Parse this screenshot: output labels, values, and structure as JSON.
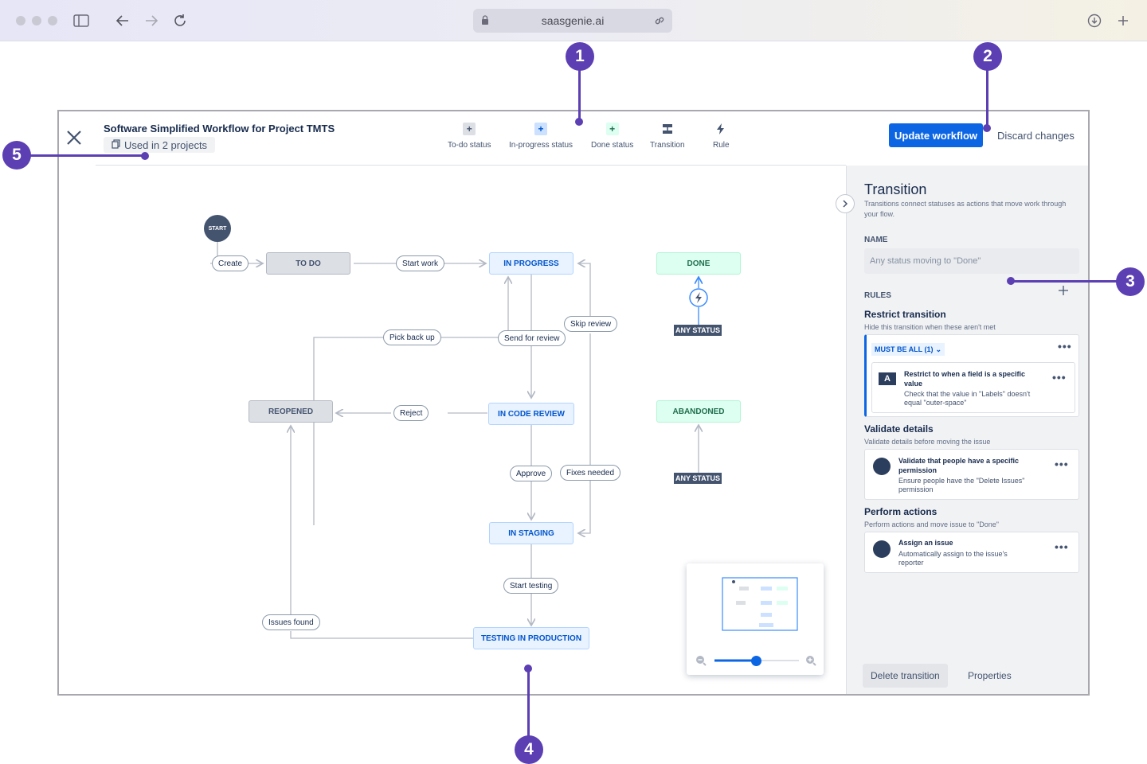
{
  "browser": {
    "url": "saasgenie.ai"
  },
  "markers": [
    "1",
    "2",
    "3",
    "4",
    "5"
  ],
  "header": {
    "workflow_title": "Software Simplified Workflow for Project TMTS",
    "used_badge": "Used in 2 projects",
    "update_button": "Update workflow",
    "discard_button": "Discard changes"
  },
  "toolbar": {
    "todo": "To-do status",
    "inprogress": "In-progress status",
    "done": "Done status",
    "transition": "Transition",
    "rule": "Rule"
  },
  "diagram": {
    "start": "START",
    "statuses": {
      "todo": "TO DO",
      "in_progress": "IN PROGRESS",
      "done": "DONE",
      "reopened": "REOPENED",
      "in_code_review": "IN CODE REVIEW",
      "abandoned": "ABANDONED",
      "in_staging": "IN STAGING",
      "testing_in_production": "TESTING IN PRODUCTION"
    },
    "transitions": {
      "create": "Create",
      "start_work": "Start work",
      "skip_review": "Skip review",
      "pick_back_up": "Pick back up",
      "send_for_review": "Send for review",
      "reject": "Reject",
      "approve": "Approve",
      "fixes_needed": "Fixes needed",
      "start_testing": "Start testing",
      "issues_found": "Issues found"
    },
    "any_status": "ANY STATUS"
  },
  "panel": {
    "title": "Transition",
    "description": "Transitions connect statuses as actions that move work through your flow.",
    "name_label": "NAME",
    "name_placeholder": "Any status moving to \"Done\"",
    "rules_label": "RULES",
    "restrict": {
      "title": "Restrict transition",
      "desc": "Hide this transition when these aren't met",
      "must_be_all": "MUST BE ALL (1)",
      "rule_title": "Restrict to when a field is a specific value",
      "rule_desc": "Check that the value in \"Labels\" doesn't equal \"outer-space\""
    },
    "validate": {
      "title": "Validate details",
      "desc": "Validate details before moving the issue",
      "rule_title": "Validate that people have a specific permission",
      "rule_desc": "Ensure people have the \"Delete Issues\" permission"
    },
    "perform": {
      "title": "Perform actions",
      "desc": "Perform actions and move issue to \"Done\"",
      "rule_title": "Assign an issue",
      "rule_desc": "Automatically assign to the issue's reporter"
    },
    "delete_button": "Delete transition",
    "properties_button": "Properties"
  },
  "colors": {
    "marker": "#5b3fb3",
    "primary": "#0c66e4"
  },
  "minimap": {
    "zoom_level": 0.5
  }
}
